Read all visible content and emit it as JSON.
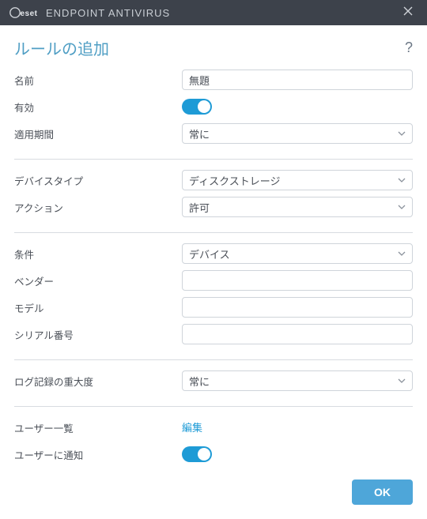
{
  "titlebar": {
    "product": "ENDPOINT ANTIVIRUS"
  },
  "header": {
    "title": "ルールの追加"
  },
  "labels": {
    "name": "名前",
    "enabled": "有効",
    "period": "適用期間",
    "deviceType": "デバイスタイプ",
    "action": "アクション",
    "condition": "条件",
    "vendor": "ベンダー",
    "model": "モデル",
    "serial": "シリアル番号",
    "logSeverity": "ログ記録の重大度",
    "userList": "ユーザー一覧",
    "notifyUser": "ユーザーに通知"
  },
  "values": {
    "name": "無題",
    "period": "常に",
    "deviceType": "ディスクストレージ",
    "action": "許可",
    "condition": "デバイス",
    "vendor": "",
    "model": "",
    "serial": "",
    "logSeverity": "常に",
    "userListLink": "編集"
  },
  "footer": {
    "ok": "OK"
  }
}
